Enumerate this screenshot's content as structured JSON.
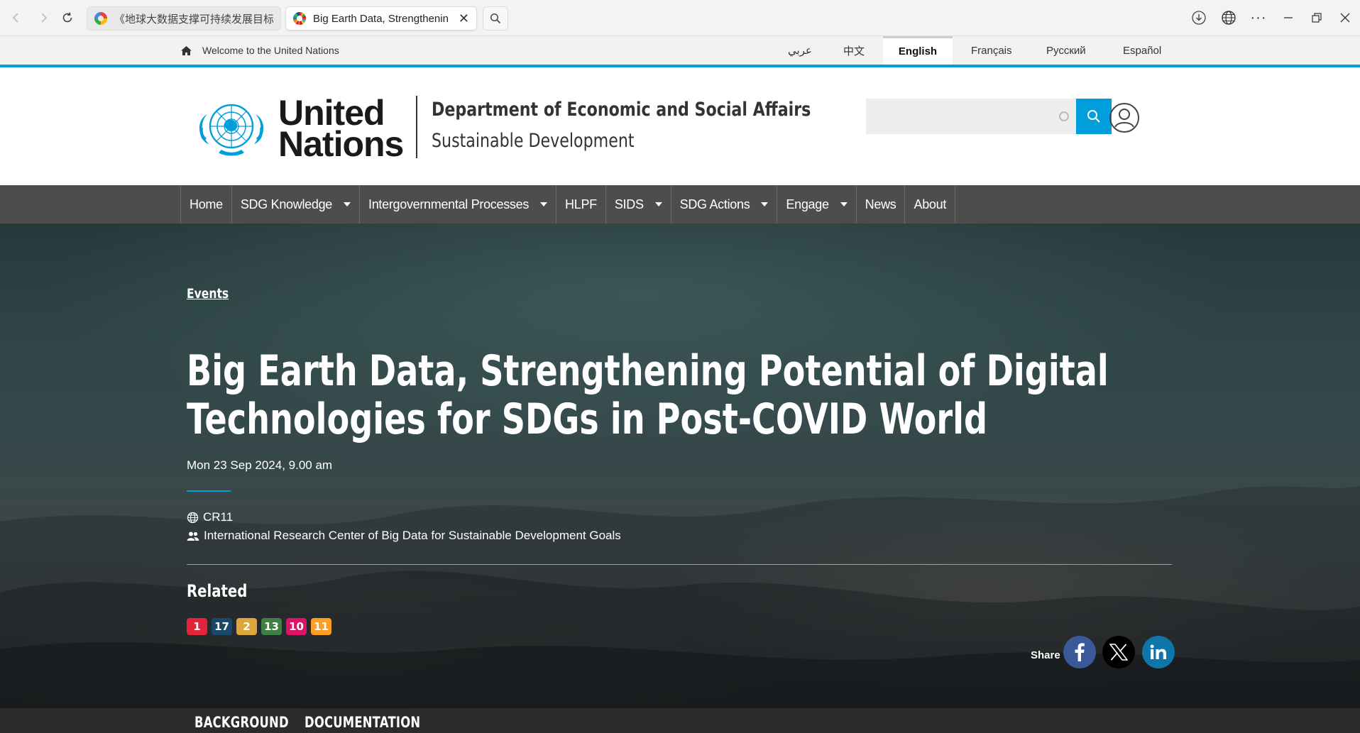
{
  "browser": {
    "tabs": [
      {
        "title": "《地球大数据支撑可持续发展目标",
        "favicon_color": "#4285f4"
      },
      {
        "title": "Big Earth Data, Strengthenin",
        "favicon_color": "#e5243b"
      }
    ],
    "icons": [
      "back-icon",
      "forward-icon",
      "reload-icon",
      "search-icon",
      "download-icon",
      "globe-icon",
      "more-icon",
      "minimize-icon",
      "restore-icon",
      "close-icon"
    ]
  },
  "topbar": {
    "welcome": "Welcome to the United Nations",
    "languages": [
      "عربي",
      "中文",
      "English",
      "Français",
      "Русский",
      "Español"
    ],
    "current_language": "English"
  },
  "header": {
    "brand_line1": "United",
    "brand_line2": "Nations",
    "department": "Department of Economic and Social Affairs",
    "subtitle": "Sustainable Development",
    "search_placeholder": "",
    "accent_color": "#009edb"
  },
  "nav": {
    "items": [
      {
        "label": "Home",
        "dropdown": false
      },
      {
        "label": "SDG Knowledge",
        "dropdown": true
      },
      {
        "label": "Intergovernmental Processes",
        "dropdown": true
      },
      {
        "label": "HLPF",
        "dropdown": false
      },
      {
        "label": "SIDS",
        "dropdown": true
      },
      {
        "label": "SDG Actions",
        "dropdown": true
      },
      {
        "label": "Engage",
        "dropdown": true
      },
      {
        "label": "News",
        "dropdown": false
      },
      {
        "label": "About",
        "dropdown": false
      }
    ]
  },
  "event": {
    "breadcrumb": "Events",
    "title_line1": "Big Earth Data, Strengthening Potential of Digital",
    "title_line2": "Technologies for SDGs in Post-COVID World",
    "date": "Mon 23 Sep 2024, 9.00 am",
    "location": "CR11",
    "organizer": "International Research Center of Big Data for Sustainable Development Goals",
    "related_label": "Related",
    "sdgs": [
      {
        "number": "1",
        "color": "#e5243b"
      },
      {
        "number": "17",
        "color": "#19486a"
      },
      {
        "number": "2",
        "color": "#dda63a"
      },
      {
        "number": "13",
        "color": "#3f7e44"
      },
      {
        "number": "10",
        "color": "#dd1367"
      },
      {
        "number": "11",
        "color": "#fd9d24"
      }
    ],
    "share_label": "Share",
    "share": [
      {
        "network": "facebook-icon",
        "glyph": "f",
        "color": "#3b5998"
      },
      {
        "network": "x-icon",
        "glyph": "X",
        "color": "#000000"
      },
      {
        "network": "linkedin-icon",
        "glyph": "in",
        "color": "#0e76a8"
      }
    ]
  },
  "bottom_tabs": [
    "BACKGROUND",
    "DOCUMENTATION"
  ]
}
